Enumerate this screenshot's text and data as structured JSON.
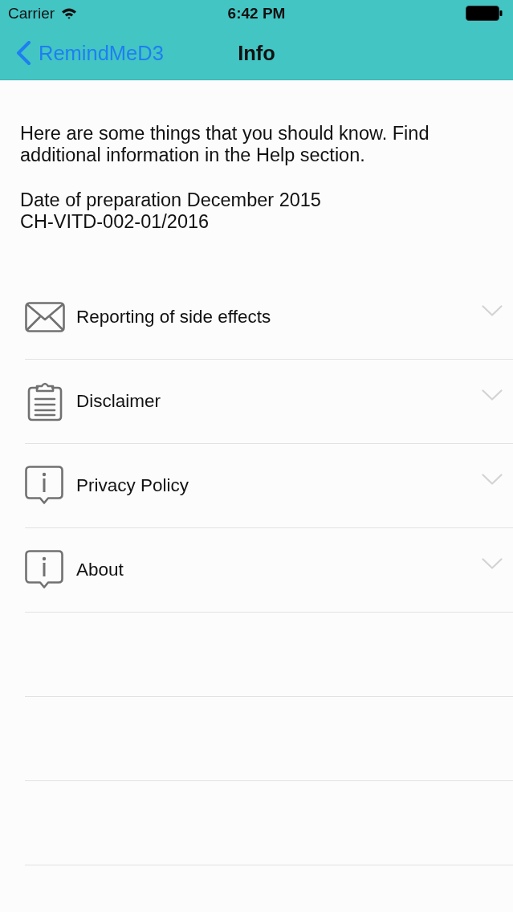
{
  "status_bar": {
    "carrier": "Carrier",
    "time": "6:42 PM"
  },
  "nav_bar": {
    "back_label": "RemindMeD3",
    "title": "Info"
  },
  "intro": {
    "text": "Here are some things that you should know. Find additional information in the Help section.",
    "lines": [
      "Date of preparation December 2015",
      "CH-VITD-002-01/2016"
    ]
  },
  "sections": [
    {
      "kind": "mail",
      "label": "Reporting of side effects",
      "expanded": false
    },
    {
      "kind": "clipboard",
      "label": "Disclaimer",
      "expanded": false
    },
    {
      "kind": "info",
      "label": "Privacy Policy",
      "expanded": false
    },
    {
      "kind": "info",
      "label": "About",
      "expanded": false
    }
  ]
}
